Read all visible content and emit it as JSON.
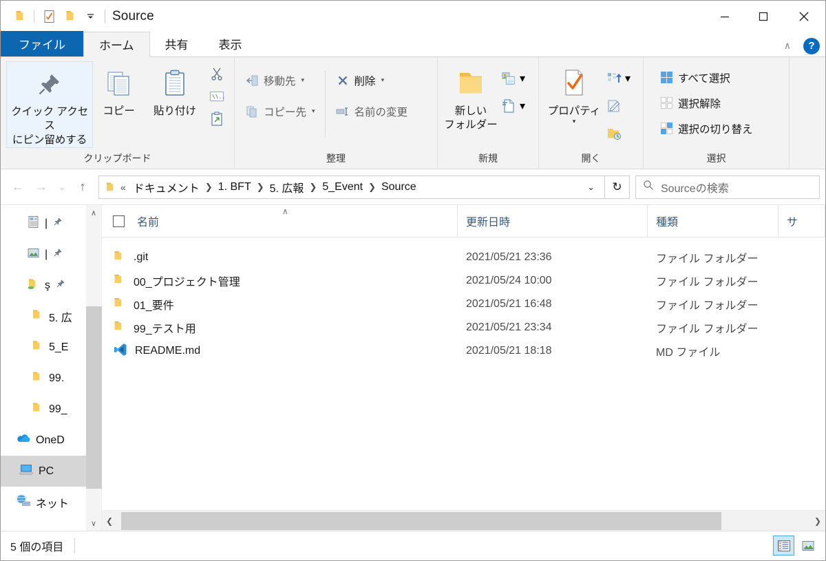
{
  "window": {
    "title": "Source",
    "controls": {
      "minimize": "─",
      "maximize": "□",
      "close": "✕"
    }
  },
  "quick_access_toolbar": {
    "items": [
      {
        "name": "properties-folder-icon",
        "label": ""
      },
      {
        "name": "new-folder-checked-icon",
        "label": ""
      },
      {
        "name": "folder-icon",
        "label": ""
      }
    ],
    "customize_caret": "➕"
  },
  "ribbon": {
    "tabs": [
      {
        "id": "file",
        "label": "ファイル",
        "active": false,
        "is_file": true
      },
      {
        "id": "home",
        "label": "ホーム",
        "active": true,
        "is_file": false
      },
      {
        "id": "share",
        "label": "共有",
        "active": false,
        "is_file": false
      },
      {
        "id": "view",
        "label": "表示",
        "active": false,
        "is_file": false
      }
    ],
    "collapse_label": "∧",
    "help_label": "?",
    "groups": [
      {
        "id": "clipboard",
        "label": "クリップボード",
        "pin_button": {
          "label_line1": "クイック アクセス",
          "label_line2": "にピン留めする"
        },
        "copy_button": {
          "label": "コピー"
        },
        "paste_button": {
          "label": "貼り付け"
        },
        "small_buttons": [
          {
            "name": "cut-icon",
            "label": ""
          },
          {
            "name": "copy-path-icon",
            "label": ""
          },
          {
            "name": "paste-shortcut-icon",
            "label": ""
          }
        ]
      },
      {
        "id": "organize",
        "label": "整理",
        "items": [
          {
            "name": "move-to-button",
            "label": "移動先",
            "caret": "▾",
            "enabled": false
          },
          {
            "name": "copy-to-button",
            "label": "コピー先",
            "caret": "▾",
            "enabled": false
          },
          {
            "name": "delete-button",
            "label": "削除",
            "caret": "▾",
            "enabled": true
          },
          {
            "name": "rename-button",
            "label": "名前の変更",
            "caret": "",
            "enabled": false
          }
        ]
      },
      {
        "id": "new",
        "label": "新規",
        "new_folder_button": {
          "label_line1": "新しい",
          "label_line2": "フォルダー"
        },
        "small_buttons": [
          {
            "name": "new-item-icon",
            "caret": "▾"
          },
          {
            "name": "easy-access-icon",
            "caret": "▾"
          }
        ]
      },
      {
        "id": "open",
        "label": "開く",
        "properties_button": {
          "label": "プロパティ",
          "caret": "▾"
        },
        "small_buttons": [
          {
            "name": "open-with-icon",
            "caret": "▾"
          },
          {
            "name": "edit-icon",
            "caret": ""
          },
          {
            "name": "history-icon",
            "caret": ""
          }
        ]
      },
      {
        "id": "select",
        "label": "選択",
        "items": [
          {
            "name": "select-all-button",
            "label": "すべて選択"
          },
          {
            "name": "select-none-button",
            "label": "選択解除"
          },
          {
            "name": "invert-selection-button",
            "label": "選択の切り替え"
          }
        ]
      }
    ]
  },
  "address_bar": {
    "back": "←",
    "forward": "→",
    "recent": "⌄",
    "up": "↑",
    "breadcrumb_overflow": "«",
    "breadcrumbs": [
      "ドキュメント",
      "1. BFT",
      "5. 広報",
      "5_Event",
      "Source"
    ],
    "separator": "❯",
    "dropdown": "⌄",
    "refresh": "↻",
    "search_placeholder": "Sourceの検索"
  },
  "nav_pane": {
    "items": [
      {
        "name": "sidebar-item-documents",
        "label": "|",
        "icon": "document-icon",
        "pinned": true,
        "selected": false,
        "indent": 1
      },
      {
        "name": "sidebar-item-pictures",
        "label": "|",
        "icon": "picture-icon",
        "pinned": true,
        "selected": false,
        "indent": 1
      },
      {
        "name": "sidebar-item-shared-folder",
        "label": "ş",
        "icon": "shared-folder-icon",
        "pinned": true,
        "selected": false,
        "indent": 1
      },
      {
        "name": "sidebar-item-koho",
        "label": "5. 広",
        "icon": "folder-icon",
        "pinned": false,
        "selected": false,
        "indent": 2
      },
      {
        "name": "sidebar-item-5event",
        "label": "5_E",
        "icon": "folder-icon",
        "pinned": false,
        "selected": false,
        "indent": 2
      },
      {
        "name": "sidebar-item-99dot",
        "label": "99.",
        "icon": "folder-icon",
        "pinned": false,
        "selected": false,
        "indent": 2
      },
      {
        "name": "sidebar-item-99us",
        "label": "99_",
        "icon": "folder-icon",
        "pinned": false,
        "selected": false,
        "indent": 2
      },
      {
        "name": "sidebar-item-onedrive",
        "label": "OneD",
        "icon": "onedrive-icon",
        "pinned": false,
        "selected": false,
        "indent": 0
      },
      {
        "name": "sidebar-item-pc",
        "label": "PC",
        "icon": "pc-icon",
        "pinned": false,
        "selected": true,
        "indent": 0
      },
      {
        "name": "sidebar-item-network",
        "label": "ネット",
        "icon": "network-icon",
        "pinned": false,
        "selected": false,
        "indent": 0
      }
    ],
    "scroll_up": "∧",
    "scroll_down": "∨"
  },
  "file_list": {
    "columns": [
      {
        "key": "name",
        "label": "名前",
        "sorted": true,
        "sort_dir": "∧"
      },
      {
        "key": "date",
        "label": "更新日時",
        "sorted": false
      },
      {
        "key": "type",
        "label": "種類",
        "sorted": false
      },
      {
        "key": "size",
        "label": "サ",
        "sorted": false
      }
    ],
    "rows": [
      {
        "name": ".git",
        "date": "2021/05/21 23:36",
        "type": "ファイル フォルダー",
        "size": "",
        "icon": "folder-icon"
      },
      {
        "name": "00_プロジェクト管理",
        "date": "2021/05/24 10:00",
        "type": "ファイル フォルダー",
        "size": "",
        "icon": "folder-icon"
      },
      {
        "name": "01_要件",
        "date": "2021/05/21 16:48",
        "type": "ファイル フォルダー",
        "size": "",
        "icon": "folder-icon"
      },
      {
        "name": "99_テスト用",
        "date": "2021/05/21 23:34",
        "type": "ファイル フォルダー",
        "size": "",
        "icon": "folder-icon"
      },
      {
        "name": "README.md",
        "date": "2021/05/21 18:18",
        "type": "MD ファイル",
        "size": "",
        "icon": "vscode-icon"
      }
    ],
    "hscroll_left": "❮",
    "hscroll_right": "❯"
  },
  "status_bar": {
    "item_count": "5 個の項目",
    "view_details": "details-view-icon",
    "view_large_icons": "large-icons-view-icon"
  },
  "colors": {
    "file_tab_blue": "#0c66b0",
    "help_blue": "#0a6bbd",
    "selection_blue": "#cce8f7",
    "selection_border": "#4ca5dd",
    "nav_selected": "#d6d6d6",
    "ribbon_bg": "#f3f3f3",
    "folder_yellow": "#fcd77f",
    "header_text": "#3d5a76"
  }
}
